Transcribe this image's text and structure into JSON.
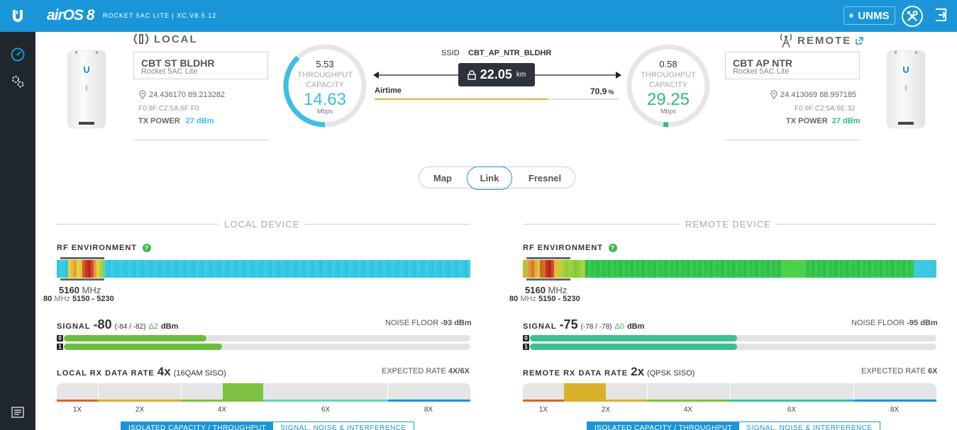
{
  "topbar": {
    "title": "airOS 8",
    "subtitle": "ROCKET 5AC LITE | XC.V8.5.12",
    "unms_label": "UNMS"
  },
  "local": {
    "header": "LOCAL",
    "name": "CBT ST BLDHR",
    "model": "Rocket 5AC Lite",
    "coords": "24.436170 89.213282",
    "mac": "F0:9F:C2:5A:6F:F0",
    "tx_power_label": "TX POWER",
    "tx_power": "27 dBm",
    "gauge": {
      "top": "5.53",
      "label1": "THROUGHPUT",
      "label2": "CAPACITY",
      "value": "14.63",
      "unit": "Mbps",
      "fraction": 0.378
    }
  },
  "remote": {
    "header": "REMOTE",
    "name": "CBT AP NTR",
    "model": "Rocket 5AC Lite",
    "coords": "24.413069 88.997185",
    "mac": "F0:9F:C2:5A:6E:32",
    "tx_power_label": "TX POWER",
    "tx_power": "27 dBm",
    "gauge": {
      "top": "0.58",
      "label1": "THROUGHPUT",
      "label2": "CAPACITY",
      "value": "29.25",
      "unit": "Mbps",
      "fraction": 0.02
    }
  },
  "link": {
    "ssid_label": "SSID",
    "ssid": "CBT_AP_NTR_BLDHR",
    "distance": "22.05",
    "distance_unit": "km",
    "airtime_label": "Airtime",
    "airtime": "70.9",
    "airtime_unit": "%",
    "airtime_fraction": 0.709
  },
  "view_tabs": {
    "map": "Map",
    "link": "Link",
    "fresnel": "Fresnel",
    "active": "link"
  },
  "local_device": {
    "section": "LOCAL DEVICE",
    "rf_label": "RF ENVIRONMENT",
    "freq": "5160",
    "freq_unit": "MHz",
    "width": "80",
    "width_unit": "MHz",
    "range": "5150 - 5230",
    "signal_label": "SIGNAL",
    "signal": "-80",
    "signal_chains": "(-84 / -82)",
    "signal_delta": "Δ2",
    "signal_unit": "dBm",
    "noise_label": "NOISE FLOOR",
    "noise": "-93 dBm",
    "chain0_fraction": 0.35,
    "chain1_fraction": 0.39,
    "chain_color": "#6cbf3e",
    "rx_label": "LOCAL RX DATA RATE",
    "rx_rate": "4x",
    "rx_mode": "(16QAM SISO)",
    "expected_label": "EXPECTED RATE",
    "expected": "4X/6X",
    "rate_ticks": [
      "1X",
      "2X",
      "4X",
      "6X",
      "8X"
    ],
    "rate_active_color": "#7cc142",
    "tab1": "ISOLATED CAPACITY / THROUGHPUT",
    "tab2": "SIGNAL, NOISE & INTERFERENCE"
  },
  "remote_device": {
    "section": "REMOTE DEVICE",
    "rf_label": "RF ENVIRONMENT",
    "freq": "5160",
    "freq_unit": "MHz",
    "width": "80",
    "width_unit": "MHz",
    "range": "5150 - 5230",
    "signal_label": "SIGNAL",
    "signal": "-75",
    "signal_chains": "(-78 / -78)",
    "signal_delta": "Δ0",
    "signal_unit": "dBm",
    "noise_label": "NOISE FLOOR",
    "noise": "-95 dBm",
    "chain0_fraction": 0.51,
    "chain1_fraction": 0.51,
    "chain_color": "#3dbf93",
    "rx_label": "REMOTE RX DATA RATE",
    "rx_rate": "2x",
    "rx_mode": "(QPSK SISO)",
    "expected_label": "EXPECTED RATE",
    "expected": "6X",
    "rate_ticks": [
      "1X",
      "2X",
      "4X",
      "6X",
      "8X"
    ],
    "rate_active_color": "#d9b22a",
    "tab1": "ISOLATED CAPACITY / THROUGHPUT",
    "tab2": "SIGNAL, NOISE & INTERFERENCE"
  },
  "colors": {
    "accent": "#1a96d8",
    "local": "#3bbde8",
    "remote": "#2dbd7e",
    "sidebar": "#20262e"
  },
  "icons": [
    "ubiquiti-logo-icon",
    "unms-dot-icon",
    "tools-icon",
    "logout-icon",
    "dashboard-icon",
    "settings-icon",
    "log-icon",
    "antenna-local-icon",
    "tower-remote-icon",
    "external-link-icon",
    "location-pin-icon",
    "lock-icon",
    "help-icon"
  ]
}
